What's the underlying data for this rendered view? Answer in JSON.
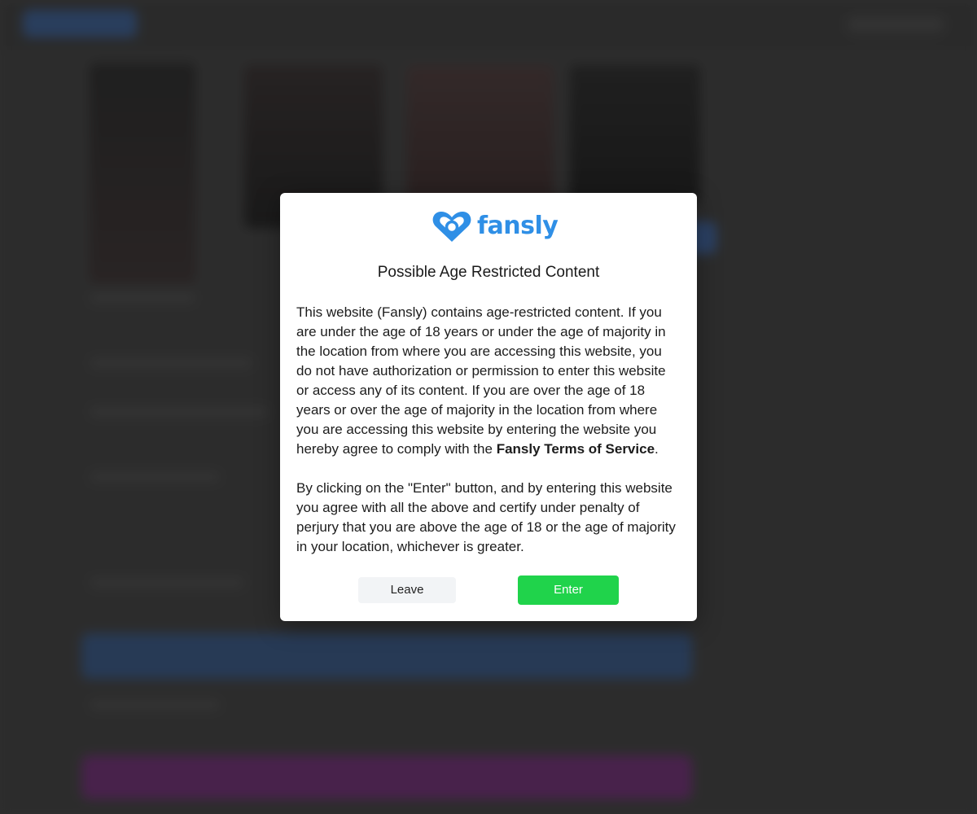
{
  "brand": {
    "name": "fansly",
    "color": "#2f8fe6"
  },
  "modal": {
    "title": "Possible Age Restricted Content",
    "paragraph1_intro": "This website (Fansly) contains age-restricted content. If you are under the age of 18 years or under the age of majority in the location from where you are accessing this website, you do not have authorization or permission to enter this website or access any of its content. If you are over the age of 18 years or over the age of majority in the location from where you are accessing this website by entering the website you hereby agree to comply with the ",
    "terms_link": "Fansly Terms of Service",
    "paragraph1_end": ".",
    "paragraph2": "By clicking on the \"Enter\" button, and by entering this website you agree with all the above and certify under penalty of perjury that you are above the age of 18 or the age of majority in your location, whichever is greater.",
    "leave_label": "Leave",
    "enter_label": "Enter",
    "enter_color": "#20d34b"
  }
}
